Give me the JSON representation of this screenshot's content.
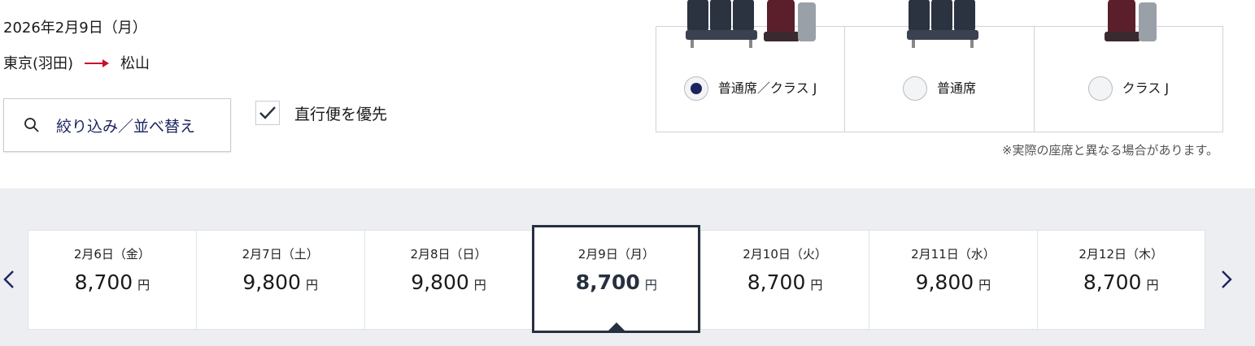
{
  "search": {
    "date": "2026年2月9日（月）",
    "origin": "東京(羽田)",
    "destination": "松山"
  },
  "filter": {
    "label": "絞り込み／並べ替え",
    "icon": "search-icon"
  },
  "direct_option": {
    "label": "直行便を優先",
    "checked": true
  },
  "seat_class": {
    "options": [
      {
        "label": "普通席／クラス J",
        "selected": true
      },
      {
        "label": "普通席",
        "selected": false
      },
      {
        "label": "クラス J",
        "selected": false
      }
    ],
    "note": "※実際の座席と異なる場合があります。"
  },
  "calendar": {
    "currency": "円",
    "days": [
      {
        "date": "2月6日（金）",
        "price": "8,700"
      },
      {
        "date": "2月7日（土）",
        "price": "9,800"
      },
      {
        "date": "2月8日（日）",
        "price": "9,800"
      },
      {
        "date": "2月9日（月）",
        "price": "8,700",
        "selected": true
      },
      {
        "date": "2月10日（火）",
        "price": "8,700"
      },
      {
        "date": "2月11日（水）",
        "price": "9,800"
      },
      {
        "date": "2月12日（木）",
        "price": "8,700"
      }
    ]
  },
  "colors": {
    "accent": "#1b2460",
    "route_arrow": "#c8102e",
    "band_bg": "#eceef1",
    "selected_border": "#27303f"
  }
}
